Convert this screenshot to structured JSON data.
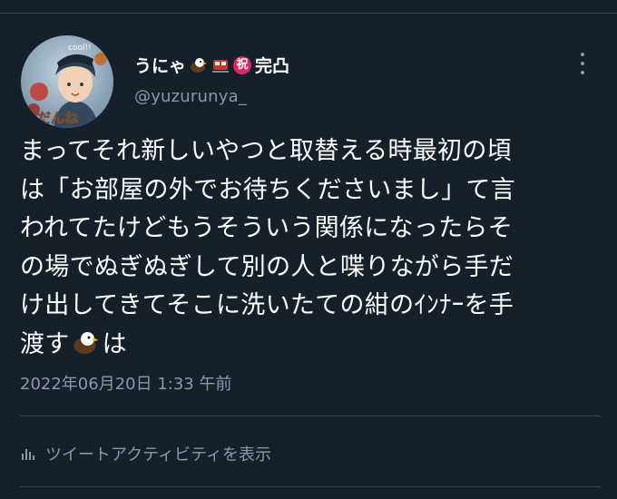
{
  "user": {
    "display_name": "うにゃ",
    "display_name_suffix": "完凸",
    "handle": "@yuzurunya_",
    "avatar_text_top": "cool!!",
    "avatar_text_bottom": "だんね",
    "badges": [
      "eagle-emoji",
      "railway-emoji",
      "celebration-emoji"
    ],
    "badge_celebration_char": "祝"
  },
  "tweet": {
    "lines": [
      "まってそれ新しいやつと取替える時最初の頃",
      "は「お部屋の外でお待ちくださいまし」て言",
      "われてたけどもうそういう関係になったらそ",
      "の場でぬぎぬぎして別の人と喋りながら手だ",
      "け出してきてそこに洗いたての紺のｲﾝﾅｰを手"
    ],
    "last_line_start": "渡す",
    "last_line_end": "は",
    "timestamp": "2022年06月20日 1:33 午前"
  },
  "actions": {
    "activity_label": "ツイートアクティビティを表示"
  },
  "colors": {
    "background": "#15202b",
    "text": "#ffffff",
    "secondary_text": "#8b98a5",
    "divider": "#38444d"
  }
}
